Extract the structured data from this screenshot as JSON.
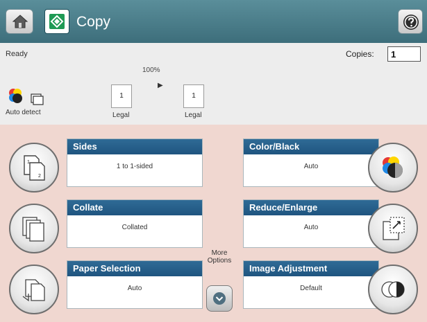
{
  "header": {
    "title": "Copy",
    "home_icon": "home-icon",
    "app_icon": "copy-start-icon",
    "help_icon": "help-icon"
  },
  "status": {
    "text": "Ready",
    "copies_label": "Copies:",
    "copies_value": "1",
    "zoom": "100%",
    "auto_detect_label": "Auto detect",
    "original_page_number": "1",
    "original_size": "Legal",
    "output_page_number": "1",
    "output_size": "Legal"
  },
  "options": {
    "sides": {
      "label": "Sides",
      "value": "1 to 1-sided"
    },
    "collate": {
      "label": "Collate",
      "value": "Collated"
    },
    "paper_selection": {
      "label": "Paper Selection",
      "value": "Auto"
    },
    "color_black": {
      "label": "Color/Black",
      "value": "Auto"
    },
    "reduce_enlarge": {
      "label": "Reduce/Enlarge",
      "value": "Auto"
    },
    "image_adjustment": {
      "label": "Image Adjustment",
      "value": "Default"
    }
  },
  "more_options": {
    "label": "More Options"
  },
  "colors": {
    "titlebar": "#3d6e7b",
    "panel_header": "#1f5580",
    "main_background": "#f0d7d0",
    "status_background": "#ededed"
  }
}
